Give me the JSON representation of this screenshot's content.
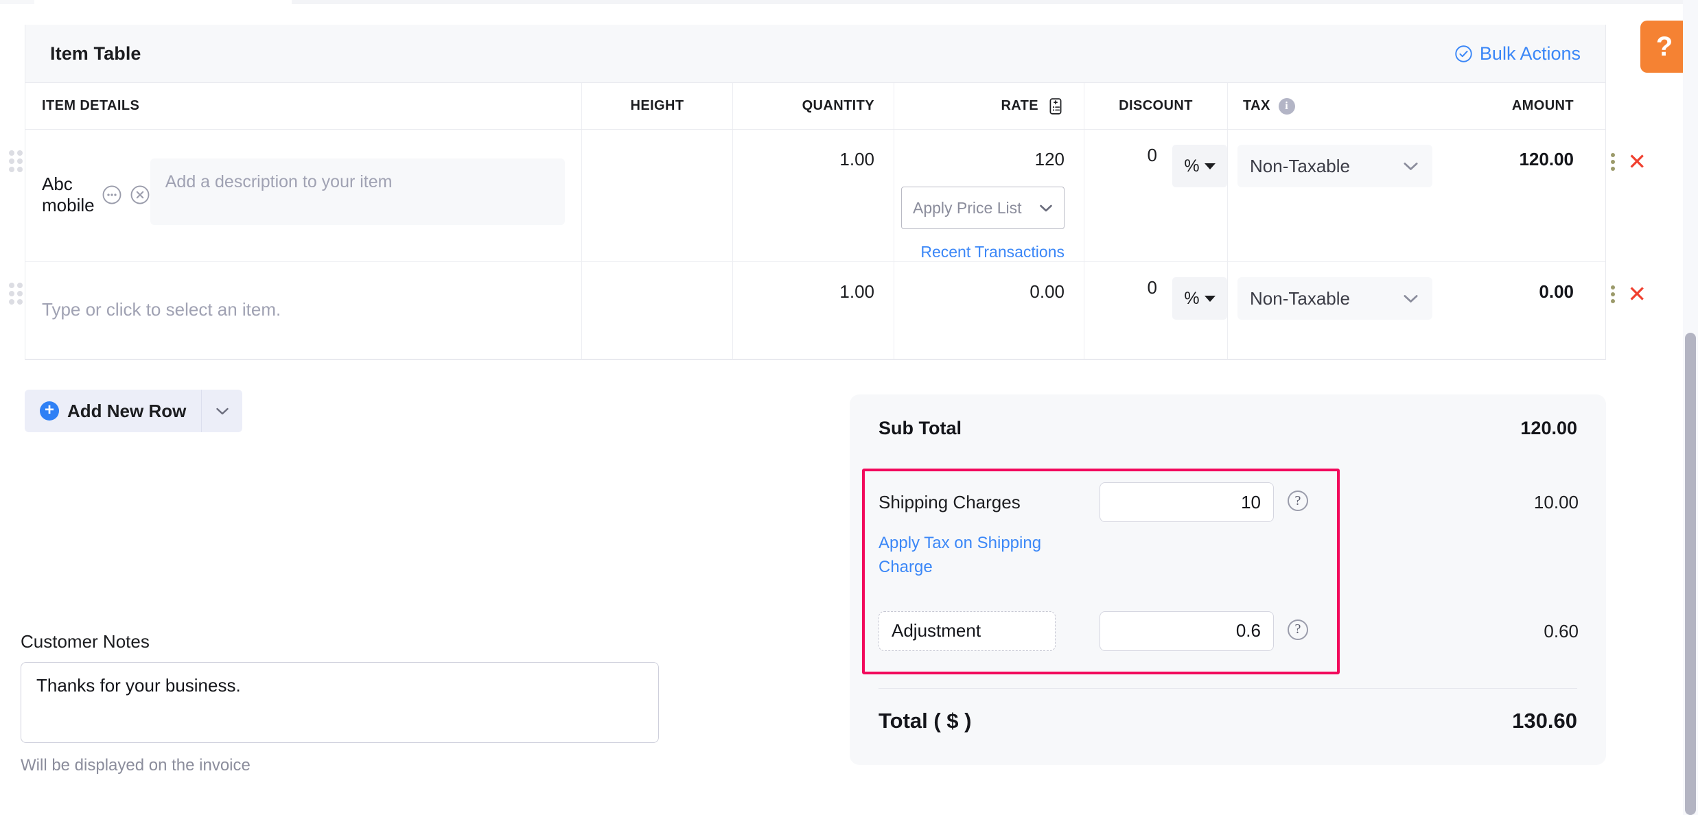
{
  "card": {
    "title": "Item Table",
    "bulk_actions_label": "Bulk Actions",
    "bulk_actions_icon": "check-circle-icon"
  },
  "columns": {
    "item_details": "ITEM DETAILS",
    "height": "HEIGHT",
    "quantity": "QUANTITY",
    "rate": "RATE",
    "rate_icon": "price-list-icon",
    "discount": "DISCOUNT",
    "tax": "TAX",
    "tax_icon": "info-icon",
    "amount": "AMOUNT"
  },
  "rows": [
    {
      "name": "Abc mobile",
      "description_placeholder": "Add a description to your item",
      "height": "",
      "quantity": "1.00",
      "rate": "120",
      "price_list_placeholder": "Apply Price List",
      "recent_transactions_label": "Recent Transactions",
      "discount": "0",
      "discount_unit": "%",
      "tax": "Non-Taxable",
      "amount": "120.00",
      "more_icon": "ellipsis-circle-icon",
      "remove_icon": "close-circle-icon",
      "kebab_icon": "kebab-menu-icon",
      "delete_icon": "red-x-icon"
    },
    {
      "name_placeholder": "Type or click to select an item.",
      "height": "",
      "quantity": "1.00",
      "rate": "0.00",
      "discount": "0",
      "discount_unit": "%",
      "tax": "Non-Taxable",
      "amount": "0.00",
      "kebab_icon": "kebab-menu-icon",
      "delete_icon": "red-x-icon"
    }
  ],
  "add_row": {
    "label": "Add New Row",
    "plus_icon": "plus-circle-icon",
    "caret_icon": "chevron-down-icon"
  },
  "notes": {
    "label": "Customer Notes",
    "value": "Thanks for your business.",
    "hint": "Will be displayed on the invoice"
  },
  "totals": {
    "sub_total_label": "Sub Total",
    "sub_total_value": "120.00",
    "shipping_label": "Shipping Charges",
    "shipping_value": "10",
    "shipping_amount": "10.00",
    "apply_tax_link": "Apply Tax on Shipping Charge",
    "adjustment_name": "Adjustment",
    "adjustment_value": "0.6",
    "adjustment_amount": "0.60",
    "help_icon": "question-circle-icon",
    "total_label": "Total ( $ )",
    "total_value": "130.60",
    "highlight_color": "#f2095c"
  },
  "help_fab": {
    "label": "?",
    "color": "#f58233"
  }
}
